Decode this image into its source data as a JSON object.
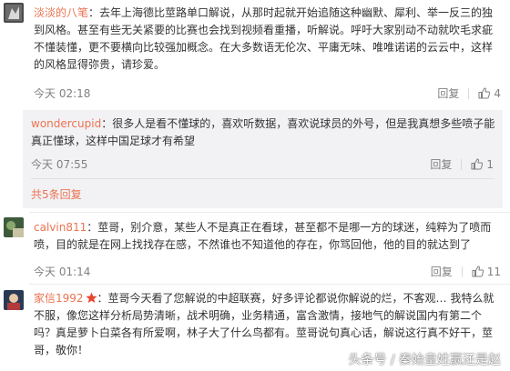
{
  "comments": [
    {
      "user": "淡淡的八笔",
      "text": "：去年上海德比莖路单口解说，从那时起就开始追随这种幽默、犀利、举一反三的独到风格。甚至有些无关紧要的比赛也会找到视频看重播，听解说。呼吁大家别动不动就吹毛求疵不懂装懂，更不要横向比较强加概念。在大多数语无伦次、平庸无味、唯唯诺诺的云云中，这样的风格显得弥贵，请珍爱。",
      "time": "今天 02:18",
      "reply": "回复",
      "likes": "4"
    },
    {
      "user": "wondercupid",
      "text": "：很多人是看不懂球的，喜欢听数据，喜欢说球员的外号，但是我真想多些喷子能真正懂球，这样中国足球才有希望",
      "time": "今天 07:55",
      "reply": "回复",
      "likes": "1"
    },
    {
      "user": "calvin811",
      "text": "：莖哥，别介意，某些人不是真正在看球，甚至都不是哪一方的球迷，纯粹为了喷而喷，目的就是在网上找找存在感，不然谁也不知道他的存在，你骂回他，他的目的就达到了",
      "time": "今天 01:14",
      "reply": "回复",
      "likes": "11"
    },
    {
      "user": "家信1992",
      "text": "：莖哥今天看了您解说的中超联赛，好多评论都说你解说的烂，不客观… 我特么就不服，像您这样分析局势清晰，战术明确，业务精通，富含激情，接地气的解说国内有第二个吗？真是萝卜白菜各有所爱啊，林子大了什么鸟都有。莖哥说句真心话，解说这行真不好干，莖哥，敬你！"
    }
  ],
  "more_replies": "共5条回复",
  "watermark": "头条号 / 秦始皇姓赢还是赵",
  "colors": {
    "username": "#eb7350",
    "meta": "#808080",
    "subbox_bg": "#f2f2f5",
    "vip": "#e8462e"
  }
}
